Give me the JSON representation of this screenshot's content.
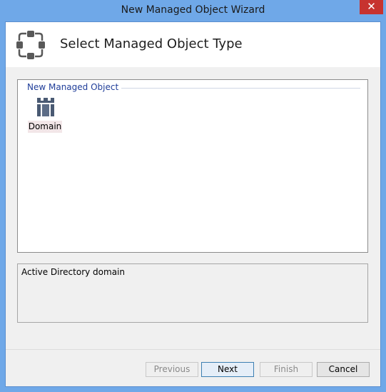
{
  "window": {
    "title": "New Managed Object Wizard",
    "close_glyph": "✕"
  },
  "header": {
    "title": "Select Managed Object Type",
    "icon": "managed-object-icon"
  },
  "group": {
    "label": "New Managed Object"
  },
  "items": [
    {
      "label": "Domain",
      "icon": "domain-icon"
    }
  ],
  "description": {
    "text": "Active Directory domain"
  },
  "buttons": {
    "previous": "Previous",
    "next": "Next",
    "finish": "Finish",
    "cancel": "Cancel"
  },
  "colors": {
    "title_bar": "#6fa8e8",
    "close_button": "#c7332f",
    "group_label": "#1f3d99",
    "icon_fill": "#4a5a73"
  }
}
